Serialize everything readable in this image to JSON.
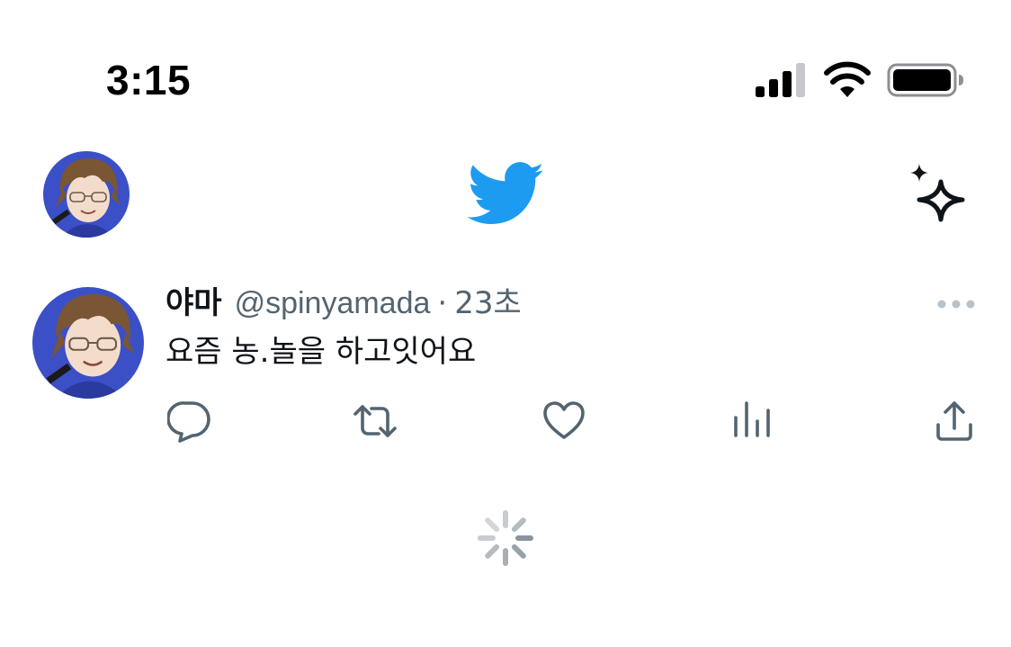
{
  "status_bar": {
    "time": "3:15",
    "signal_icon": "cellular-signal-icon",
    "wifi_icon": "wifi-icon",
    "battery_icon": "battery-icon"
  },
  "header": {
    "profile_avatar": "avatar",
    "logo_icon": "twitter-bird-icon",
    "timeline_icon": "sparkle-icon"
  },
  "tweet": {
    "display_name": "야마",
    "handle": "@spinyamada",
    "separator": "·",
    "age": "23초",
    "text": "요즘 농.놀을 하고잇어요",
    "more_icon": "more-horizontal-icon",
    "actions": [
      {
        "name": "reply",
        "icon": "reply-icon"
      },
      {
        "name": "retweet",
        "icon": "retweet-icon"
      },
      {
        "name": "like",
        "icon": "heart-icon"
      },
      {
        "name": "views",
        "icon": "analytics-icon"
      },
      {
        "name": "share",
        "icon": "share-icon"
      }
    ]
  },
  "loading": {
    "icon": "loading-spinner-icon"
  },
  "colors": {
    "twitter_blue": "#1d9bf0",
    "secondary_text": "#536471",
    "primary_text": "#0f1419"
  }
}
